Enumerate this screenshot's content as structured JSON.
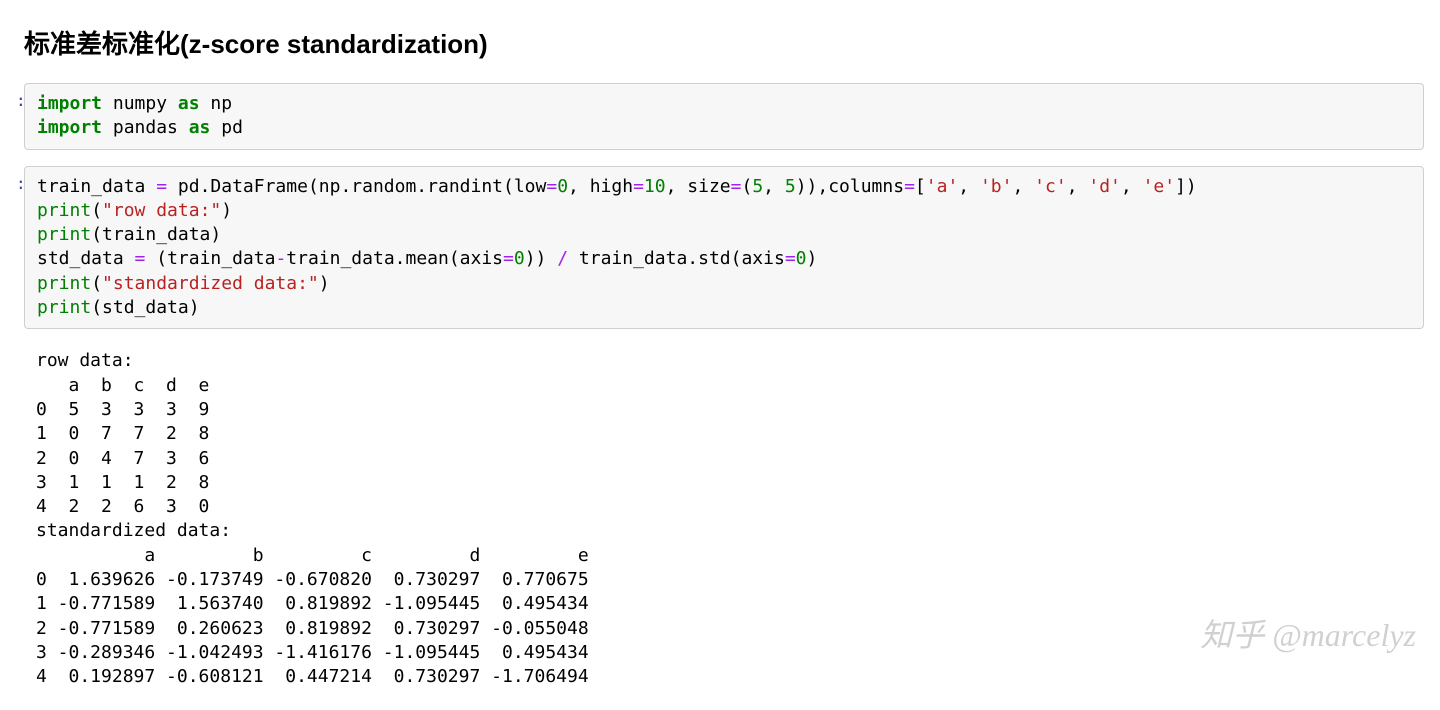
{
  "heading": "标准差标准化(z-score standardization)",
  "prompt_marker": ":",
  "cell1": {
    "tokens": [
      {
        "t": "import ",
        "c": "kw"
      },
      {
        "t": "numpy ",
        "c": "nn"
      },
      {
        "t": "as ",
        "c": "kw"
      },
      {
        "t": "np",
        "c": "nn"
      },
      {
        "t": "\n",
        "c": ""
      },
      {
        "t": "import ",
        "c": "kw"
      },
      {
        "t": "pandas ",
        "c": "nn"
      },
      {
        "t": "as ",
        "c": "kw"
      },
      {
        "t": "pd",
        "c": "nn"
      }
    ]
  },
  "cell2": {
    "tokens": [
      {
        "t": "train_data ",
        "c": "nn"
      },
      {
        "t": "=",
        "c": "op"
      },
      {
        "t": " pd.DataFrame(np.random.randint(low",
        "c": "nn"
      },
      {
        "t": "=",
        "c": "op"
      },
      {
        "t": "0",
        "c": "num"
      },
      {
        "t": ", high",
        "c": "nn"
      },
      {
        "t": "=",
        "c": "op"
      },
      {
        "t": "10",
        "c": "num"
      },
      {
        "t": ", size",
        "c": "nn"
      },
      {
        "t": "=",
        "c": "op"
      },
      {
        "t": "(",
        "c": "paren"
      },
      {
        "t": "5",
        "c": "num"
      },
      {
        "t": ", ",
        "c": "nn"
      },
      {
        "t": "5",
        "c": "num"
      },
      {
        "t": ")),columns",
        "c": "nn"
      },
      {
        "t": "=",
        "c": "op"
      },
      {
        "t": "[",
        "c": "paren"
      },
      {
        "t": "'a'",
        "c": "str"
      },
      {
        "t": ", ",
        "c": "nn"
      },
      {
        "t": "'b'",
        "c": "str"
      },
      {
        "t": ", ",
        "c": "nn"
      },
      {
        "t": "'c'",
        "c": "str"
      },
      {
        "t": ", ",
        "c": "nn"
      },
      {
        "t": "'d'",
        "c": "str"
      },
      {
        "t": ", ",
        "c": "nn"
      },
      {
        "t": "'e'",
        "c": "str"
      },
      {
        "t": "])",
        "c": "paren"
      },
      {
        "t": "\n",
        "c": ""
      },
      {
        "t": "print",
        "c": "builtin"
      },
      {
        "t": "(",
        "c": "paren"
      },
      {
        "t": "\"row data:\"",
        "c": "str"
      },
      {
        "t": ")",
        "c": "paren"
      },
      {
        "t": "\n",
        "c": ""
      },
      {
        "t": "print",
        "c": "builtin"
      },
      {
        "t": "(train_data)",
        "c": "nn"
      },
      {
        "t": "\n",
        "c": ""
      },
      {
        "t": "std_data ",
        "c": "nn"
      },
      {
        "t": "=",
        "c": "op"
      },
      {
        "t": " (train_data",
        "c": "nn"
      },
      {
        "t": "-",
        "c": "op"
      },
      {
        "t": "train_data.mean(axis",
        "c": "nn"
      },
      {
        "t": "=",
        "c": "op"
      },
      {
        "t": "0",
        "c": "num"
      },
      {
        "t": ")) ",
        "c": "nn"
      },
      {
        "t": "/",
        "c": "op"
      },
      {
        "t": " train_data.std(axis",
        "c": "nn"
      },
      {
        "t": "=",
        "c": "op"
      },
      {
        "t": "0",
        "c": "num"
      },
      {
        "t": ")",
        "c": "paren"
      },
      {
        "t": "\n",
        "c": ""
      },
      {
        "t": "print",
        "c": "builtin"
      },
      {
        "t": "(",
        "c": "paren"
      },
      {
        "t": "\"standardized data:\"",
        "c": "str"
      },
      {
        "t": ")",
        "c": "paren"
      },
      {
        "t": "\n",
        "c": ""
      },
      {
        "t": "print",
        "c": "builtin"
      },
      {
        "t": "(std_data)",
        "c": "nn"
      }
    ]
  },
  "output_text": "row data:\n   a  b  c  d  e\n0  5  3  3  3  9\n1  0  7  7  2  8\n2  0  4  7  3  6\n3  1  1  1  2  8\n4  2  2  6  3  0\nstandardized data:\n          a         b         c         d         e\n0  1.639626 -0.173749 -0.670820  0.730297  0.770675\n1 -0.771589  1.563740  0.819892 -1.095445  0.495434\n2 -0.771589  0.260623  0.819892  0.730297 -0.055048\n3 -0.289346 -1.042493 -1.416176 -1.095445  0.495434\n4  0.192897 -0.608121  0.447214  0.730297 -1.706494",
  "watermark": "知乎 @marcelyz"
}
